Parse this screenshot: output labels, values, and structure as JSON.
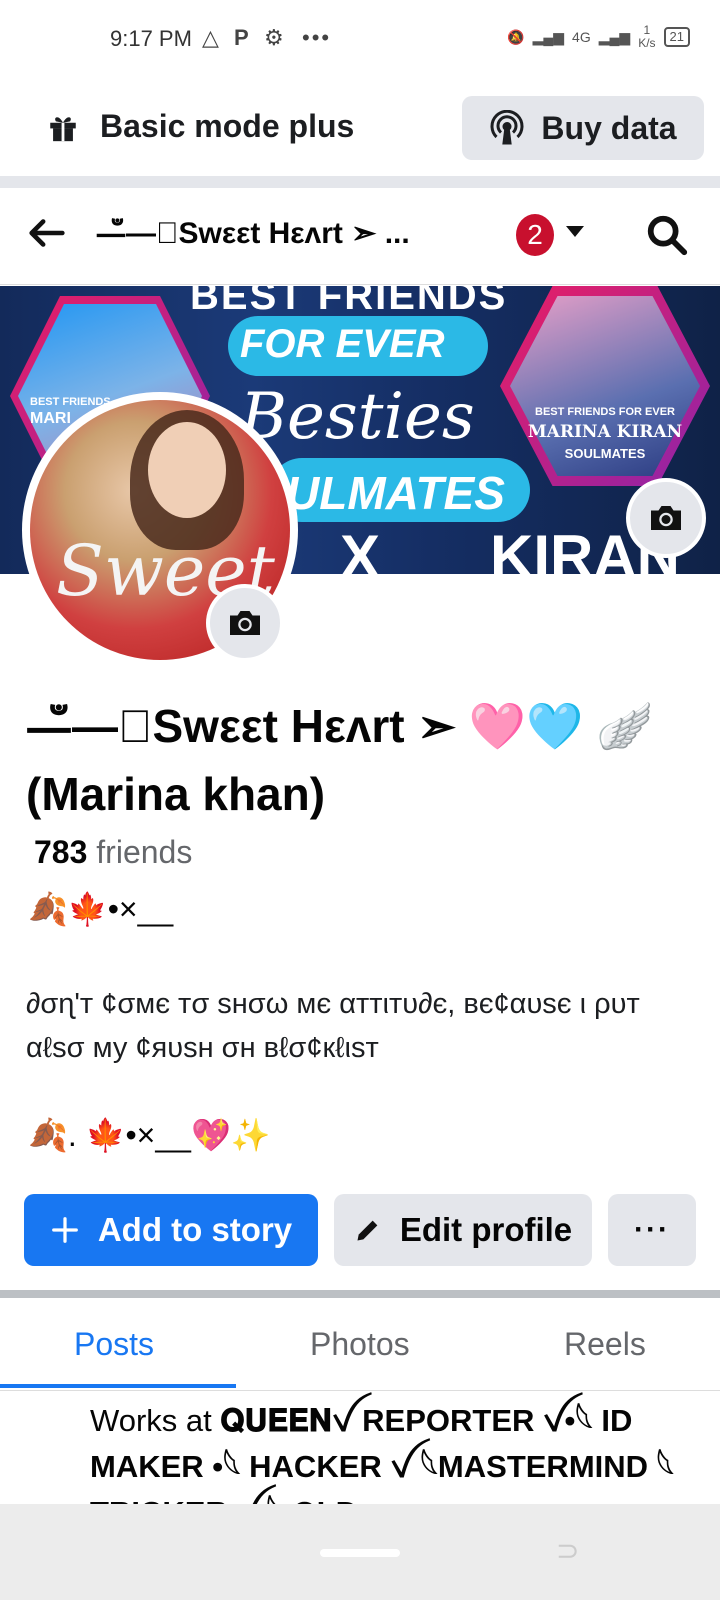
{
  "status_bar": {
    "time": "9:17 PM",
    "left_icons": [
      "warning-triangle-icon",
      "p-icon",
      "gear-icon",
      "more-dots-icon"
    ],
    "network": "4G",
    "speed": "1",
    "speed_unit": "K/s",
    "battery": "21"
  },
  "mode_bar": {
    "label": "Basic mode plus",
    "buy_label": "Buy data"
  },
  "header": {
    "title": "—ఀ—⃝Swεεt Hεʌrt ➣ ...",
    "notification_count": "2"
  },
  "cover": {
    "line1": "BEST FRIENDS",
    "line2": "FOR EVER",
    "line3": "Besties",
    "line4": "ULMATES",
    "line5": "X",
    "line6": "KIRAN",
    "left_badge": "BEST FRIENDS",
    "left_badge2": "MARI",
    "right_caption": "BEST FRIENDS FOR EVER",
    "right_names": "MARINA   KIRAN",
    "right_sub": "SOULMATES"
  },
  "avatar": {
    "overlay_text": "Sweet"
  },
  "profile": {
    "name": "—ఀ—⃝Swεεt Hεʌrt  ➣ 🩷🩵 🪽 (Marina khan)",
    "friends_count": "783",
    "friends_label": "friends",
    "bio_line1": "🍂🍁•×__",
    "bio_line2": "∂σɳ'т ¢σмє тσ ѕнσω мє αттιтυ∂є, вє¢αυѕє ι ρυт αℓѕσ му ¢яυѕн σн вℓσ¢кℓιѕт",
    "bio_line3": "🍂. 🍁•×__💖✨"
  },
  "actions": {
    "add_story": "Add to story",
    "edit_profile": "Edit profile",
    "more": "···"
  },
  "tabs": [
    {
      "label": "Posts",
      "active": true
    },
    {
      "label": "Photos",
      "active": false
    },
    {
      "label": "Reels",
      "active": false
    }
  ],
  "works": {
    "prefix": "Works at ",
    "text": "𝐐𝐔𝐄𝐄𝐍ꪜ REPORTER ꪜ•𓆩 ID MAKER •𓆩 HACKER ꪜ 𓆩MASTERMIND 𓆩 TRICKER ꪜ 𓆩 OLD"
  }
}
